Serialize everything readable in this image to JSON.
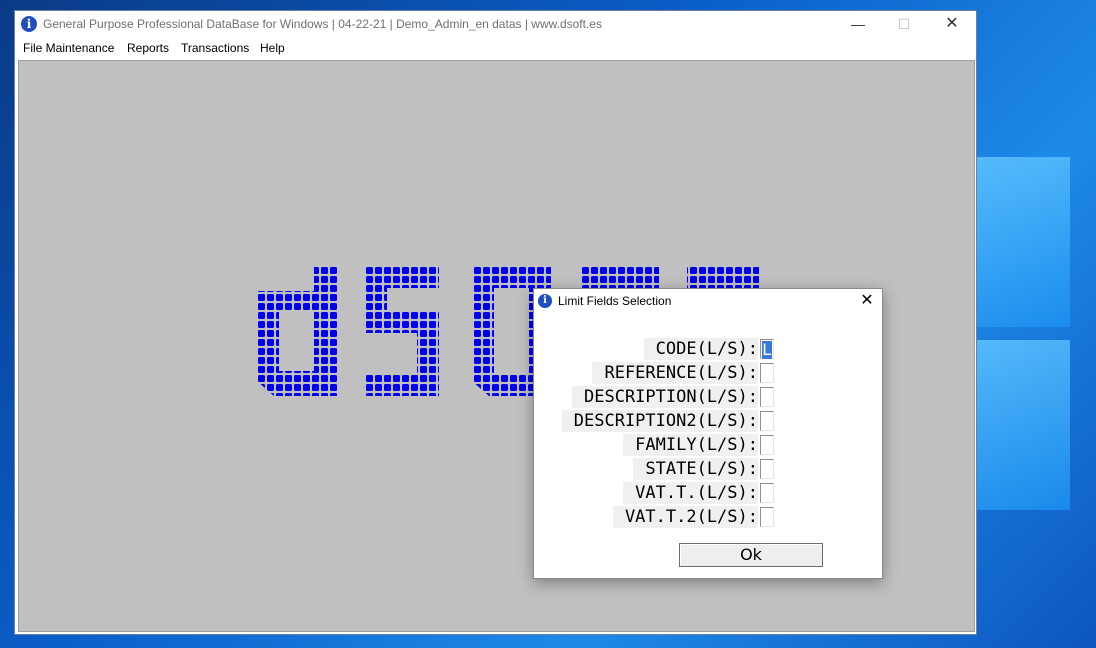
{
  "window": {
    "title": "General Purpose Professional DataBase for Windows  |  04-22-21  |  Demo_Admin_en datas |  www.dsoft.es",
    "controls": {
      "minimize": "—",
      "maximize": "☐",
      "close": "✕"
    }
  },
  "menu": {
    "items": [
      {
        "label": "File Maintenance"
      },
      {
        "label": "Reports"
      },
      {
        "label": "Transactions"
      },
      {
        "label": "Help"
      }
    ]
  },
  "background_logo": {
    "text": "dsoft",
    "color": "#0000ee"
  },
  "dialog": {
    "title": "Limit Fields Selection",
    "close_label": "✕",
    "fields": [
      {
        "label": "CODE(L/S):",
        "value": "L"
      },
      {
        "label": "REFERENCE(L/S):",
        "value": ""
      },
      {
        "label": "DESCRIPTION(L/S):",
        "value": ""
      },
      {
        "label": "DESCRIPTION2(L/S):",
        "value": ""
      },
      {
        "label": "FAMILY(L/S):",
        "value": ""
      },
      {
        "label": "STATE(L/S):",
        "value": ""
      },
      {
        "label": "VAT.T.(L/S):",
        "value": ""
      },
      {
        "label": "VAT.T.2(L/S):",
        "value": ""
      }
    ],
    "ok_label": "Ok"
  },
  "colors": {
    "desktop": "#0a5ec8",
    "client_area": "#c0c0c0",
    "logo_dots": "#0000ee",
    "selection": "#3a78d8"
  },
  "icons": {
    "app": "info-icon",
    "dialog": "info-icon"
  }
}
